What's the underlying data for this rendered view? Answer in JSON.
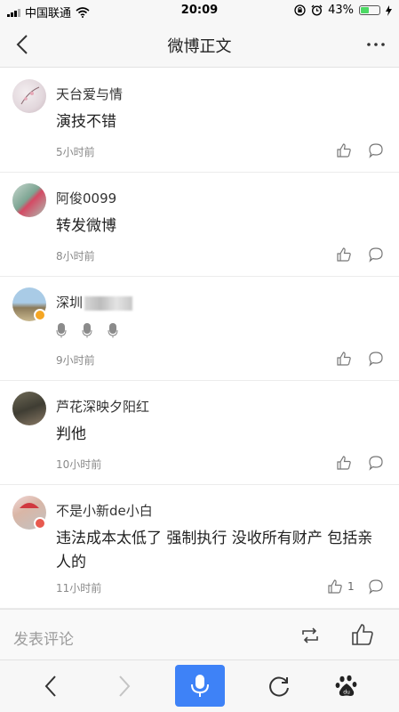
{
  "status_bar": {
    "carrier": "中国联通",
    "time": "20:09",
    "battery_percent": "43%",
    "battery_level": 0.43
  },
  "header": {
    "title": "微博正文"
  },
  "comments": [
    {
      "username": "天台爱与情",
      "text": "演技不错",
      "time": "5小时前",
      "likes": ""
    },
    {
      "username": "阿俊0099",
      "text": "转发微博",
      "time": "8小时前",
      "likes": ""
    },
    {
      "username": "深圳",
      "text": "",
      "time": "9小时前",
      "likes": ""
    },
    {
      "username": "芦花深映夕阳红",
      "text": "判他",
      "time": "10小时前",
      "likes": ""
    },
    {
      "username": "不是小新de小白",
      "text": "违法成本太低了 强制执行 没收所有财产 包括亲人的",
      "time": "11小时前",
      "likes": "1"
    }
  ],
  "comment_input": {
    "placeholder": "发表评论"
  },
  "colors": {
    "accent": "#3e82f7",
    "battery": "#4cd964",
    "muted_text": "#8a8a8a",
    "verified_badge": "#f5a623"
  },
  "icons": [
    "wifi-icon",
    "lock-rotation-icon",
    "alarm-icon",
    "charging-icon",
    "back-arrow-icon",
    "more-icon",
    "like-icon",
    "comment-icon",
    "repost-icon",
    "mic-icon",
    "refresh-icon",
    "baidu-paw-icon",
    "forward-arrow-icon"
  ]
}
